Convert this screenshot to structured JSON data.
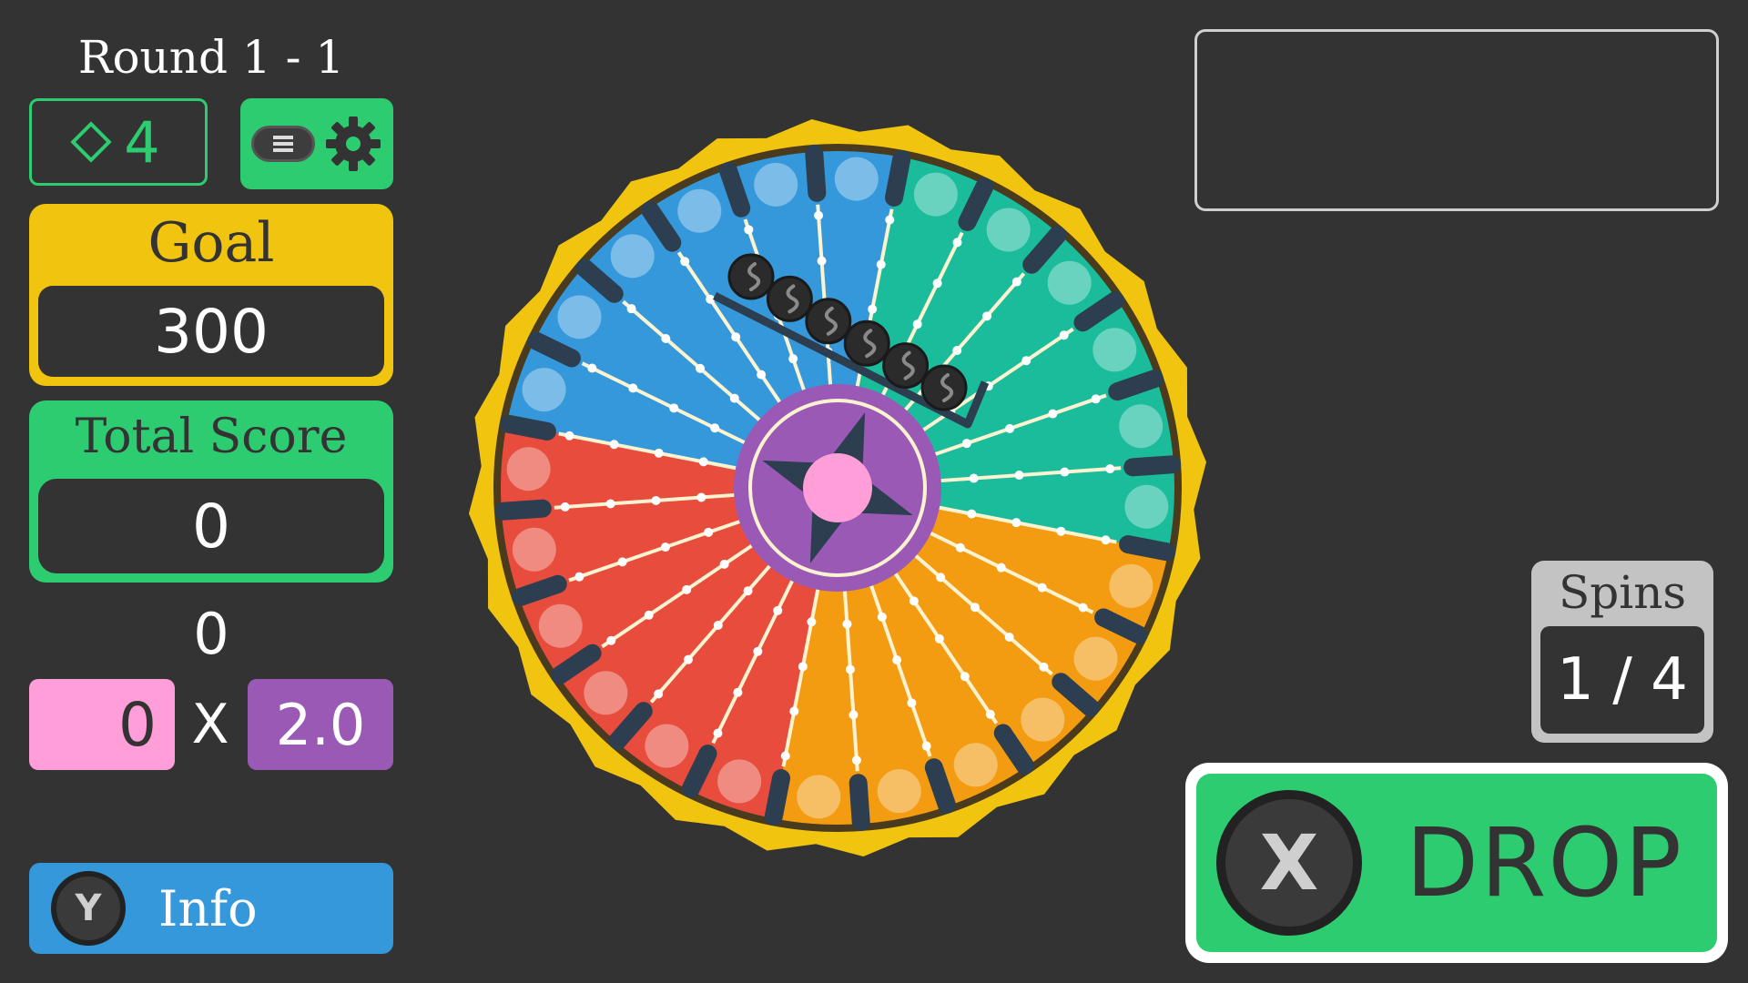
{
  "round": {
    "title": "Round 1 - 1"
  },
  "gems": {
    "count": "4",
    "icon": "diamond-icon"
  },
  "menu": {
    "icons": [
      "menu-icon",
      "gear-icon"
    ]
  },
  "goal": {
    "label": "Goal",
    "value": "300"
  },
  "total_score": {
    "label": "Total Score",
    "value": "0"
  },
  "pending": {
    "score": "0",
    "base": "0",
    "times": "X",
    "multiplier": "2.0"
  },
  "info_button": {
    "key": "Y",
    "label": "Info"
  },
  "spins": {
    "label": "Spins",
    "value": "1 / 4"
  },
  "drop_button": {
    "key": "X",
    "label": "DROP"
  },
  "wheel": {
    "segments_per_color": 6,
    "segment_colors": [
      "#e74c3c",
      "#3498db",
      "#1abc9c",
      "#f39c12"
    ],
    "rim_color": "#f1c40f",
    "hub_color": "#9b59b6",
    "hub_center_color": "#ff9ed8",
    "balls_in_chute": 6
  },
  "colors": {
    "background": "#333333",
    "green": "#2ecc71",
    "yellow": "#f1c40f",
    "blue": "#3498db",
    "pink": "#ff9ed8",
    "purple": "#9b59b6",
    "gray": "#c3c3c3"
  }
}
